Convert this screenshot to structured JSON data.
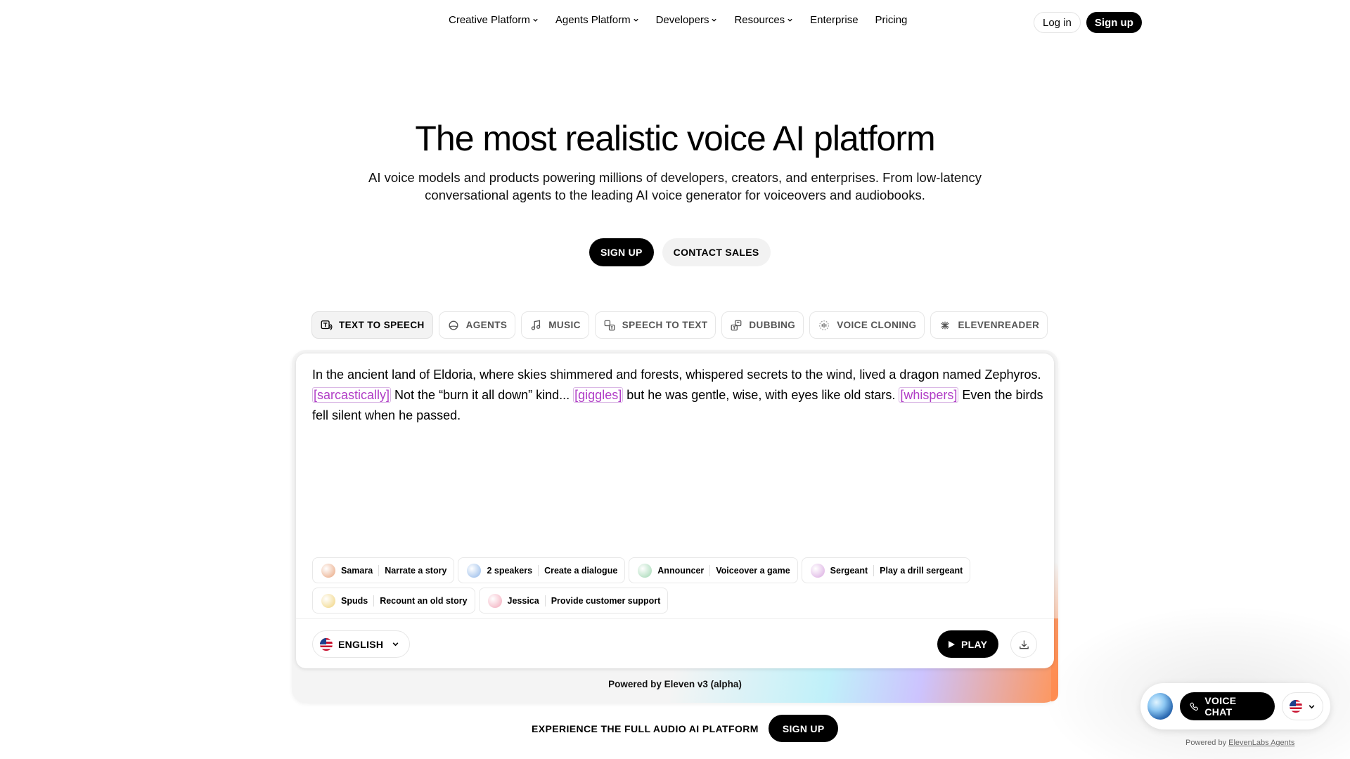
{
  "nav": {
    "links": [
      {
        "label": "Creative Platform",
        "dropdown": true
      },
      {
        "label": "Agents Platform",
        "dropdown": true
      },
      {
        "label": "Developers",
        "dropdown": true
      },
      {
        "label": "Resources",
        "dropdown": true
      },
      {
        "label": "Enterprise",
        "dropdown": false
      },
      {
        "label": "Pricing",
        "dropdown": false
      }
    ],
    "login_label": "Log in",
    "signup_label": "Sign up"
  },
  "hero": {
    "title": "The most realistic voice AI platform",
    "subtitle": "AI voice models and products powering millions of developers, creators, and enterprises. From low-latency conversational agents to the leading AI voice generator for voiceovers and audiobooks.",
    "primary_cta": "SIGN UP",
    "secondary_cta": "CONTACT SALES"
  },
  "tabs": [
    {
      "label": "TEXT TO SPEECH",
      "icon": "text-to-speech-icon",
      "active": true
    },
    {
      "label": "AGENTS",
      "icon": "agents-icon",
      "active": false
    },
    {
      "label": "MUSIC",
      "icon": "music-note-icon",
      "active": false
    },
    {
      "label": "SPEECH TO TEXT",
      "icon": "speech-to-text-icon",
      "active": false
    },
    {
      "label": "DUBBING",
      "icon": "dubbing-icon",
      "active": false
    },
    {
      "label": "VOICE CLONING",
      "icon": "voice-cloning-icon",
      "active": false
    },
    {
      "label": "ELEVENREADER",
      "icon": "elevenreader-icon",
      "active": false
    }
  ],
  "editor": {
    "story": {
      "p1": "In the ancient land of Eldoria, where skies shimmered and forests, whispered secrets to the wind, lived a dragon named Zephyros. ",
      "tag1": "[sarcastically]",
      "p2": " Not the “burn it all down” kind... ",
      "tag2": "[giggles]",
      "p3": " but he was gentle, wise, with eyes like old stars. ",
      "tag3": "[whispers]",
      "p4": " Even the birds fell silent when he passed."
    },
    "presets": [
      {
        "voice": "Samara",
        "action": "Narrate a story",
        "color": "#e8a37c"
      },
      {
        "voice": "2 speakers",
        "action": "Create a dialogue",
        "color": "#8fb6e8"
      },
      {
        "voice": "Announcer",
        "action": "Voiceover a game",
        "color": "#9ed6b0"
      },
      {
        "voice": "Sergeant",
        "action": "Play a drill sergeant",
        "color": "#d9a8e0"
      },
      {
        "voice": "Spuds",
        "action": "Recount an old story",
        "color": "#f0d27a"
      },
      {
        "voice": "Jessica",
        "action": "Provide customer support",
        "color": "#f2a6b8"
      }
    ],
    "language": "ENGLISH",
    "play_label": "PLAY",
    "powered_by": "Powered by Eleven v3 (alpha)"
  },
  "bottom_cta": {
    "text": "EXPERIENCE THE FULL AUDIO AI PLATFORM",
    "button": "SIGN UP"
  },
  "widget": {
    "voice_chat_label": "VOICE CHAT",
    "powered_prefix": "Powered by ",
    "powered_link": "ElevenLabs Agents"
  }
}
